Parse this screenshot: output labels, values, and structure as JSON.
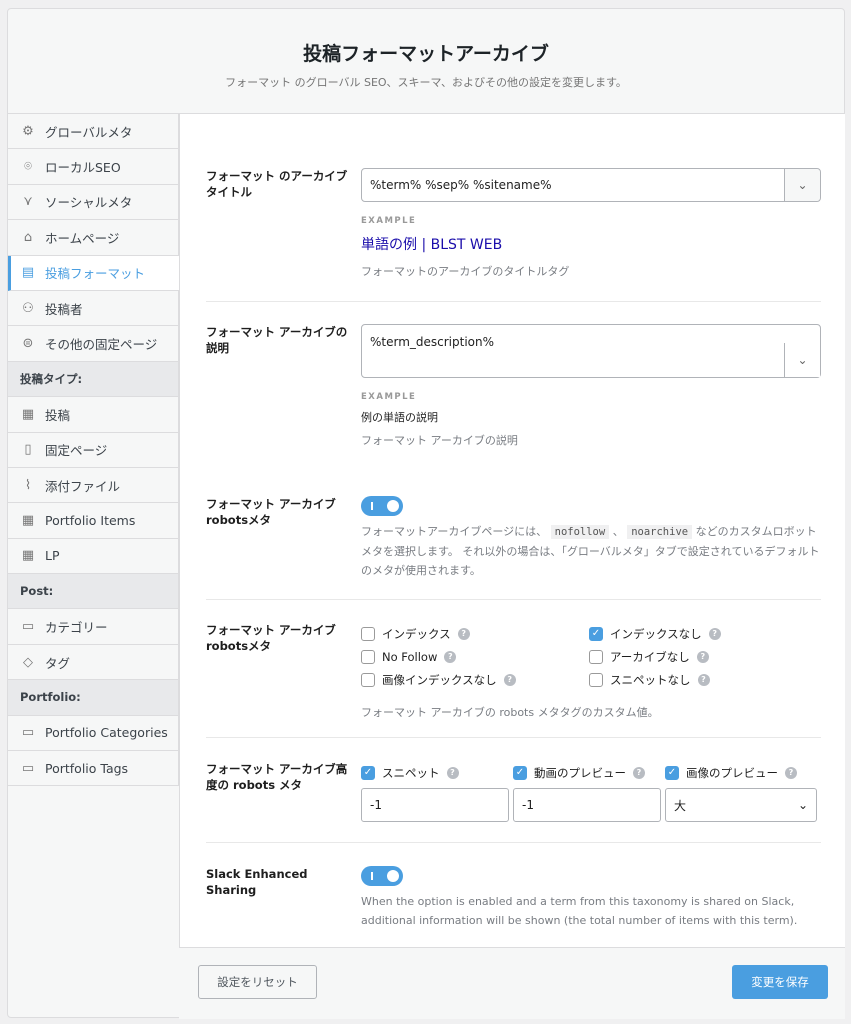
{
  "header": {
    "title": "投稿フォーマットアーカイブ",
    "subtitle": "フォーマット のグローバル SEO、スキーマ、およびその他の設定を変更します。"
  },
  "sidebar": {
    "items": [
      {
        "label": "グローバルメタ",
        "icon": "gear-icon"
      },
      {
        "label": "ローカルSEO",
        "icon": "map-pin-icon"
      },
      {
        "label": "ソーシャルメタ",
        "icon": "share-icon"
      },
      {
        "label": "ホームページ",
        "icon": "home-icon"
      },
      {
        "label": "投稿フォーマット",
        "icon": "document-icon",
        "active": true
      },
      {
        "label": "投稿者",
        "icon": "users-icon"
      },
      {
        "label": "その他の固定ページ",
        "icon": "list-icon"
      },
      {
        "section": "投稿タイプ:"
      },
      {
        "label": "投稿",
        "icon": "post-icon"
      },
      {
        "label": "固定ページ",
        "icon": "page-icon"
      },
      {
        "label": "添付ファイル",
        "icon": "paperclip-icon"
      },
      {
        "label": "Portfolio Items",
        "icon": "post-icon"
      },
      {
        "label": "LP",
        "icon": "post-icon"
      },
      {
        "section": "Post:"
      },
      {
        "label": "カテゴリー",
        "icon": "folder-icon"
      },
      {
        "label": "タグ",
        "icon": "tag-icon"
      },
      {
        "section": "Portfolio:"
      },
      {
        "label": "Portfolio Categories",
        "icon": "folder-icon"
      },
      {
        "label": "Portfolio Tags",
        "icon": "folder-icon"
      }
    ]
  },
  "title_field": {
    "label": "フォーマット のアーカイブタイトル",
    "value": "%term% %sep% %sitename%",
    "example_label": "EXAMPLE",
    "example": "単語の例 | BLST WEB",
    "help": "フォーマットのアーカイブのタイトルタグ"
  },
  "desc_field": {
    "label": "フォーマット アーカイブの説明",
    "value": "%term_description%",
    "example_label": "EXAMPLE",
    "example": "例の単語の説明",
    "help": "フォーマット アーカイブの説明"
  },
  "robots_toggle": {
    "label": "フォーマット アーカイブ robotsメタ",
    "enabled": true,
    "help_before": "フォーマットアーカイブページには、",
    "code1": "nofollow",
    "sep": "、",
    "code2": "noarchive",
    "help_after": "などのカスタムロボットメタを選択します。 それ以外の場合は、「グローバルメタ」タブで設定されているデフォルトのメタが使用されます。"
  },
  "robots_meta": {
    "label": "フォーマット アーカイブ robotsメタ",
    "options": [
      {
        "label": "インデックス",
        "checked": false
      },
      {
        "label": "インデックスなし",
        "checked": true
      },
      {
        "label": "No Follow",
        "checked": false
      },
      {
        "label": "アーカイブなし",
        "checked": false
      },
      {
        "label": "画像インデックスなし",
        "checked": false
      },
      {
        "label": "スニペットなし",
        "checked": false
      }
    ],
    "help": "フォーマット アーカイブの robots メタタグのカスタム値。"
  },
  "advanced": {
    "label": "フォーマット アーカイブ高度の robots メタ",
    "items": [
      {
        "label": "スニペット",
        "checked": true,
        "value": "-1"
      },
      {
        "label": "動画のプレビュー",
        "checked": true,
        "value": "-1"
      },
      {
        "label": "画像のプレビュー",
        "checked": true,
        "value": "大"
      }
    ]
  },
  "slack": {
    "label": "Slack Enhanced Sharing",
    "enabled": true,
    "help": "When the option is enabled and a term from this taxonomy is shared on Slack, additional information will be shown (the total number of items with this term)."
  },
  "footer": {
    "reset": "設定をリセット",
    "save": "変更を保存"
  },
  "colors": {
    "accent": "#4a9ee0",
    "example_link": "#1a0dab"
  }
}
